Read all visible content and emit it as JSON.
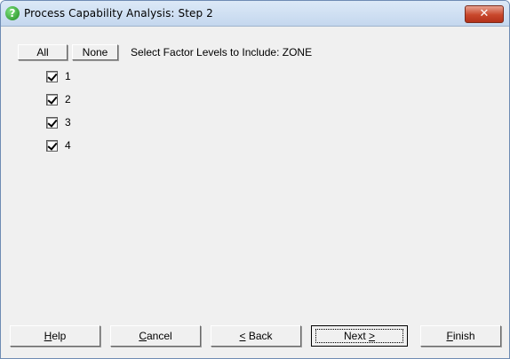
{
  "window": {
    "title": "Process Capability Analysis: Step 2",
    "close_glyph": "✕",
    "title_icon": "question-icon",
    "title_icon_glyph": "?"
  },
  "toolbar": {
    "all_label": "All",
    "none_label": "None",
    "select_label": "Select Factor Levels to Include: ZONE"
  },
  "levels": [
    {
      "label": "1",
      "checked": true
    },
    {
      "label": "2",
      "checked": true
    },
    {
      "label": "3",
      "checked": true
    },
    {
      "label": "4",
      "checked": true
    }
  ],
  "buttons": {
    "help": {
      "mnemonic": "H",
      "rest": "elp"
    },
    "cancel": {
      "mnemonic": "C",
      "rest": "ancel"
    },
    "back": {
      "mnemonic": "<",
      "rest": " Back"
    },
    "next": {
      "pre": "Next ",
      "mnemonic": ">"
    },
    "finish": {
      "mnemonic": "F",
      "rest": "inish"
    }
  },
  "colors": {
    "titlebar": "#c4d7ee",
    "close_button": "#c8472b",
    "dialog_background": "#f0f0f0"
  }
}
